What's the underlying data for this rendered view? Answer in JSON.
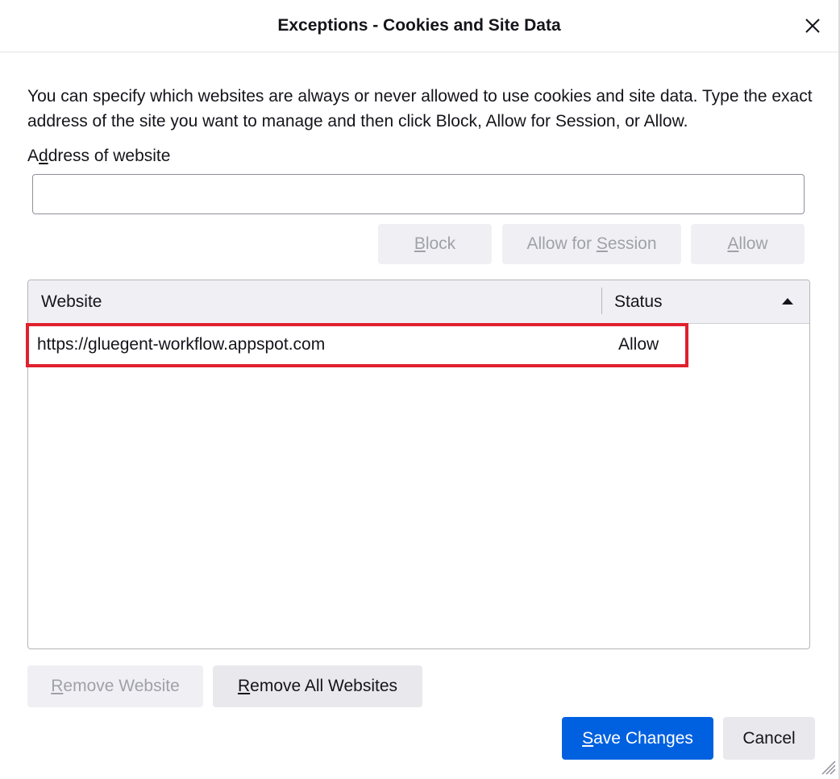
{
  "dialog": {
    "title": "Exceptions - Cookies and Site Data",
    "close_icon": "close-icon",
    "intro_text": "You can specify which websites are always or never allowed to use cookies and site data. Type the exact address of the site you want to manage and then click Block, Allow for Session, or Allow.",
    "address_label": {
      "before": "A",
      "key": "d",
      "after": "dress of website"
    },
    "address_input": {
      "value": "",
      "placeholder": ""
    },
    "buttons": {
      "block": {
        "before": "",
        "key": "B",
        "after": "lock"
      },
      "allow_session": {
        "before": "Allow for ",
        "key": "S",
        "after": "ession"
      },
      "allow": {
        "before": "",
        "key": "A",
        "after": "llow"
      },
      "remove_website": {
        "before": "",
        "key": "R",
        "after": "emove Website"
      },
      "remove_all": {
        "before": "",
        "key": "R",
        "after": "emove All Websites"
      },
      "save_changes": {
        "before": "",
        "key": "S",
        "after": "ave Changes"
      },
      "cancel": "Cancel"
    },
    "table": {
      "columns": [
        "Website",
        "Status"
      ],
      "sort_icon": "sort-ascending-icon",
      "rows": [
        {
          "website": "https://gluegent-workflow.appspot.com",
          "status": "Allow"
        }
      ]
    },
    "colors": {
      "primary": "#0061e0",
      "highlight": "#e0202e"
    }
  }
}
